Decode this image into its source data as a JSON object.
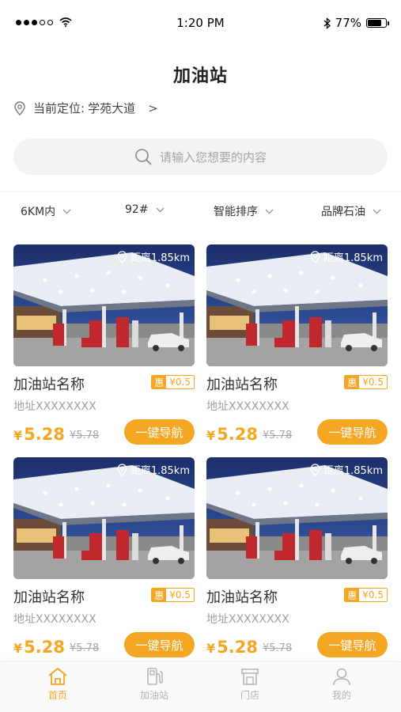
{
  "status_bar": {
    "time": "1:20 PM",
    "battery": "77%",
    "battery_level": 0.77
  },
  "header": {
    "title": "加油站"
  },
  "location": {
    "label": "当前定位:",
    "value": "学苑大道",
    "arrow": ">"
  },
  "search": {
    "placeholder": "请输入您想要的内容"
  },
  "filters": [
    {
      "label": "6KM内"
    },
    {
      "label": "92#"
    },
    {
      "label": "智能排序"
    },
    {
      "label": "品牌石油"
    }
  ],
  "stations": [
    {
      "distance": "距离1.85km",
      "name": "加油站名称",
      "discount_tag": "惠",
      "discount": "¥0.5",
      "address": "地址XXXXXXXX",
      "price_symbol": "¥",
      "price": "5.28",
      "old_price": "¥5.78",
      "nav_label": "一键导航"
    },
    {
      "distance": "距离1.85km",
      "name": "加油站名称",
      "discount_tag": "惠",
      "discount": "¥0.5",
      "address": "地址XXXXXXXX",
      "price_symbol": "¥",
      "price": "5.28",
      "old_price": "¥5.78",
      "nav_label": "一键导航"
    },
    {
      "distance": "距离1.85km",
      "name": "加油站名称",
      "discount_tag": "惠",
      "discount": "¥0.5",
      "address": "地址XXXXXXXX",
      "price_symbol": "¥",
      "price": "5.28",
      "old_price": "¥5.78",
      "nav_label": "一键导航"
    },
    {
      "distance": "距离1.85km",
      "name": "加油站名称",
      "discount_tag": "惠",
      "discount": "¥0.5",
      "address": "地址XXXXXXXX",
      "price_symbol": "¥",
      "price": "5.28",
      "old_price": "¥5.78",
      "nav_label": "一键导航"
    }
  ],
  "tabs": [
    {
      "label": "首页",
      "icon": "home-icon",
      "active": true
    },
    {
      "label": "加油站",
      "icon": "fuel-pump-icon",
      "active": false
    },
    {
      "label": "门店",
      "icon": "store-icon",
      "active": false
    },
    {
      "label": "我的",
      "icon": "user-icon",
      "active": false
    }
  ],
  "colors": {
    "accent": "#f5a623",
    "muted": "#a6a6a6",
    "search_bg": "#f2f3f5"
  }
}
